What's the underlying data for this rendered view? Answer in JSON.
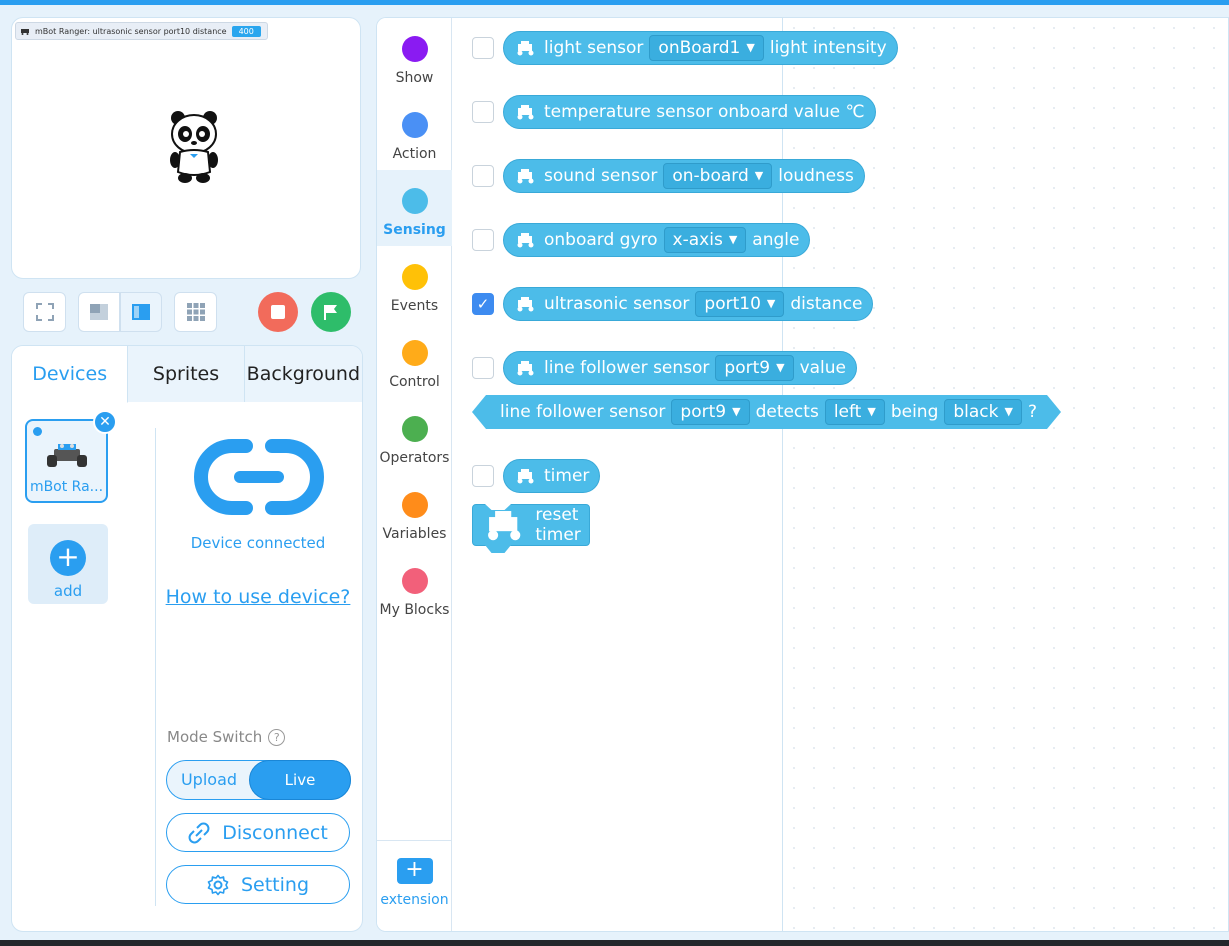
{
  "stage": {
    "monitor_label": "mBot Ranger: ultrasonic sensor port10 distance",
    "monitor_value": "400"
  },
  "tabs": [
    "Devices",
    "Sprites",
    "Background"
  ],
  "devices": {
    "device_name": "mBot Ra...",
    "add_label": "add",
    "connected_label": "Device connected",
    "howto_link": "How to use device?",
    "mode_switch_label": "Mode Switch",
    "mode_upload": "Upload",
    "mode_live": "Live",
    "disconnect_label": "Disconnect",
    "setting_label": "Setting"
  },
  "categories": [
    {
      "label": "Show",
      "color": "#8a1bf2"
    },
    {
      "label": "Action",
      "color": "#4a90f5"
    },
    {
      "label": "Sensing",
      "color": "#4cbce9"
    },
    {
      "label": "Events",
      "color": "#ffc107"
    },
    {
      "label": "Control",
      "color": "#ffab19"
    },
    {
      "label": "Operators",
      "color": "#4caf50"
    },
    {
      "label": "Variables",
      "color": "#ff8c1a"
    },
    {
      "label": "My Blocks",
      "color": "#f2607a"
    }
  ],
  "extension_label": "extension",
  "blocks": {
    "light": {
      "text1": "light sensor",
      "dd1": "onBoard1",
      "text2": "light intensity"
    },
    "temperature": {
      "text1": "temperature sensor onboard value ℃"
    },
    "sound": {
      "text1": "sound sensor",
      "dd1": "on-board",
      "text2": "loudness"
    },
    "gyro": {
      "text1": "onboard gyro",
      "dd1": "x-axis",
      "text2": "angle"
    },
    "ultrasonic": {
      "text1": "ultrasonic sensor",
      "dd1": "port10",
      "text2": "distance"
    },
    "linevalue": {
      "text1": "line follower sensor",
      "dd1": "port9",
      "text2": "value"
    },
    "linedetect": {
      "text1": "line follower sensor",
      "dd1": "port9",
      "text2": "detects",
      "dd2": "left",
      "text3": "being",
      "dd3": "black",
      "text4": "?"
    },
    "timer": {
      "text1": "timer"
    },
    "reset": {
      "text1": "reset timer"
    }
  },
  "colors": {
    "accent": "#2a9ef0",
    "sensing": "#4cbce9",
    "stop": "#f26b5b",
    "go": "#2ebd6a"
  },
  "icons": [
    "fullscreen-icon",
    "layout-small-icon",
    "layout-large-icon",
    "grid-icon",
    "stop-icon",
    "green-flag-icon",
    "robot-icon",
    "link-icon",
    "unlink-icon",
    "gear-icon",
    "help-icon",
    "plus-icon",
    "close-icon"
  ]
}
